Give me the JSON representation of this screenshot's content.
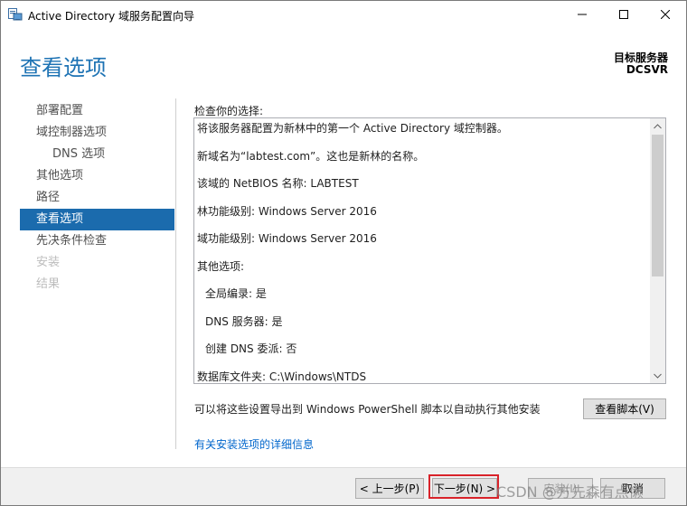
{
  "window": {
    "title": "Active Directory 域服务配置向导"
  },
  "header": {
    "page_title": "查看选项",
    "target_label": "目标服务器",
    "target_name": "DCSVR"
  },
  "nav": {
    "items": [
      {
        "label": "部署配置",
        "state": "normal"
      },
      {
        "label": "域控制器选项",
        "state": "normal"
      },
      {
        "label": "DNS 选项",
        "state": "sub"
      },
      {
        "label": "其他选项",
        "state": "normal"
      },
      {
        "label": "路径",
        "state": "normal"
      },
      {
        "label": "查看选项",
        "state": "active"
      },
      {
        "label": "先决条件检查",
        "state": "normal"
      },
      {
        "label": "安装",
        "state": "disabled"
      },
      {
        "label": "结果",
        "state": "disabled"
      }
    ]
  },
  "main": {
    "review_label": "检查你的选择:",
    "review_lines": [
      "将该服务器配置为新林中的第一个 Active Directory 域控制器。",
      "新域名为“labtest.com”。这也是新林的名称。",
      "该域的 NetBIOS 名称: LABTEST",
      "林功能级别: Windows Server 2016",
      "域功能级别: Windows Server 2016",
      "其他选项:",
      "全局编录: 是",
      "DNS 服务器: 是",
      "创建 DNS 委派: 否",
      "数据库文件夹: C:\\Windows\\NTDS"
    ],
    "export_text": "可以将这些设置导出到 Windows PowerShell 脚本以自动执行其他安装",
    "view_script_button": "查看脚本(V)",
    "more_info_link": "有关安装选项的详细信息"
  },
  "footer": {
    "prev_button": "< 上一步(P)",
    "next_button": "下一步(N) >",
    "install_button": "安装(I)",
    "cancel_button": "取消",
    "watermark": "CSDN @方先森有点懒"
  },
  "colors": {
    "accent": "#1b6bad",
    "title_blue": "#1e73b4",
    "link": "#0066cc",
    "highlight_red": "#d9232a"
  }
}
